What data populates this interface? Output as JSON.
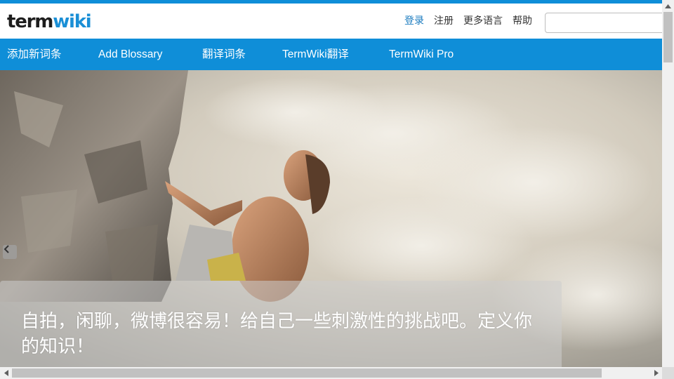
{
  "header": {
    "logo_part1": "term",
    "logo_part2": "wiki",
    "links": [
      {
        "label": "登录"
      },
      {
        "label": "注册"
      },
      {
        "label": "更多语言"
      },
      {
        "label": "帮助"
      }
    ],
    "search": {
      "value": "",
      "placeholder": ""
    }
  },
  "nav": {
    "items": [
      {
        "label": "添加新词条"
      },
      {
        "label": "Add Blossary"
      },
      {
        "label": "翻译词条"
      },
      {
        "label": "TermWiki翻译"
      },
      {
        "label": "TermWiki Pro"
      }
    ]
  },
  "hero": {
    "caption": "自拍，闲聊，微博很容易！给自己一些刺激性的挑战吧。定义你的知识！",
    "prev_icon": "chevron-left-icon"
  },
  "colors": {
    "brand_blue": "#0f8ed8",
    "link_active": "#1a7bbf",
    "logo_dark": "#1d1d1d",
    "logo_blue": "#1a8fd6"
  }
}
